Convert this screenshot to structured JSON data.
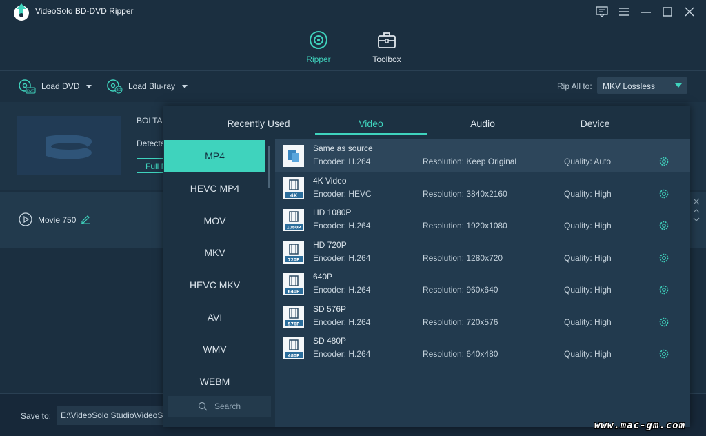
{
  "app": {
    "title": "VideoSolo BD-DVD Ripper"
  },
  "main_tabs": [
    {
      "label": "Ripper",
      "icon": "ripper-icon",
      "active": true
    },
    {
      "label": "Toolbox",
      "icon": "toolbox-icon",
      "active": false
    }
  ],
  "toolbar": {
    "load_dvd": "Load DVD",
    "load_bluray": "Load Blu-ray",
    "rip_all_label": "Rip All to:",
    "rip_all_value": "MKV Lossless"
  },
  "disc": {
    "title": "BOLTAL",
    "detected": "Detecte",
    "full_button": "Full M"
  },
  "movie": {
    "name": "Movie 750"
  },
  "bottom": {
    "save_label": "Save to:",
    "save_path": "E:\\VideoSolo Studio\\VideoS"
  },
  "format_popup": {
    "tabs": [
      {
        "label": "Recently Used",
        "active": false
      },
      {
        "label": "Video",
        "active": true
      },
      {
        "label": "Audio",
        "active": false
      },
      {
        "label": "Device",
        "active": false
      }
    ],
    "formats": [
      {
        "label": "MP4",
        "active": true
      },
      {
        "label": "HEVC MP4",
        "active": false
      },
      {
        "label": "MOV",
        "active": false
      },
      {
        "label": "MKV",
        "active": false
      },
      {
        "label": "HEVC MKV",
        "active": false
      },
      {
        "label": "AVI",
        "active": false
      },
      {
        "label": "WMV",
        "active": false
      },
      {
        "label": "WEBM",
        "active": false
      }
    ],
    "search_placeholder": "Search",
    "presets": [
      {
        "name": "Same as source",
        "badge": "",
        "encoder": "Encoder: H.264",
        "resolution": "Resolution: Keep Original",
        "quality": "Quality: Auto",
        "selected": true
      },
      {
        "name": "4K Video",
        "badge": "4K",
        "encoder": "Encoder: HEVC",
        "resolution": "Resolution: 3840x2160",
        "quality": "Quality: High",
        "selected": false
      },
      {
        "name": "HD 1080P",
        "badge": "1080P",
        "encoder": "Encoder: H.264",
        "resolution": "Resolution: 1920x1080",
        "quality": "Quality: High",
        "selected": false
      },
      {
        "name": "HD 720P",
        "badge": "720P",
        "encoder": "Encoder: H.264",
        "resolution": "Resolution: 1280x720",
        "quality": "Quality: High",
        "selected": false
      },
      {
        "name": "640P",
        "badge": "640P",
        "encoder": "Encoder: H.264",
        "resolution": "Resolution: 960x640",
        "quality": "Quality: High",
        "selected": false
      },
      {
        "name": "SD 576P",
        "badge": "576P",
        "encoder": "Encoder: H.264",
        "resolution": "Resolution: 720x576",
        "quality": "Quality: High",
        "selected": false
      },
      {
        "name": "SD 480P",
        "badge": "480P",
        "encoder": "Encoder: H.264",
        "resolution": "Resolution: 640x480",
        "quality": "Quality: High",
        "selected": false
      }
    ]
  },
  "watermark": "www.mac-gm.com",
  "colors": {
    "accent": "#3fd3bd",
    "background": "#1b2f40",
    "panel": "#223a4e"
  }
}
